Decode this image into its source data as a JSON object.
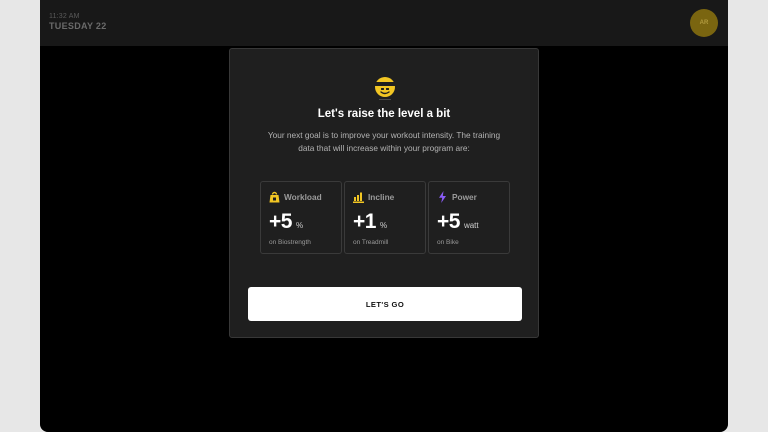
{
  "status": {
    "time": "11:32 AM",
    "date": "TUESDAY 22",
    "avatar_initials": "AR"
  },
  "modal": {
    "icon": "headband-smiley-icon",
    "title": "Let's raise the level a bit",
    "subtitle": "Your next goal is to improve your workout intensity. The training data that will increase within your program are:",
    "stats": [
      {
        "icon": "weight-icon",
        "label": "Workload",
        "value": "+5",
        "unit": "%",
        "sub": "on Biostrength"
      },
      {
        "icon": "incline-icon",
        "label": "Incline",
        "value": "+1",
        "unit": "%",
        "sub": "on Treadmill"
      },
      {
        "icon": "lightning-icon",
        "label": "Power",
        "value": "+5",
        "unit": "watt",
        "sub": "on Bike"
      }
    ],
    "cta_label": "LET'S GO"
  },
  "colors": {
    "accent_yellow": "#f2c623",
    "power_purple": "#8a5cf6",
    "modal_bg": "#1f1f1f",
    "button_bg": "#ffffff"
  }
}
